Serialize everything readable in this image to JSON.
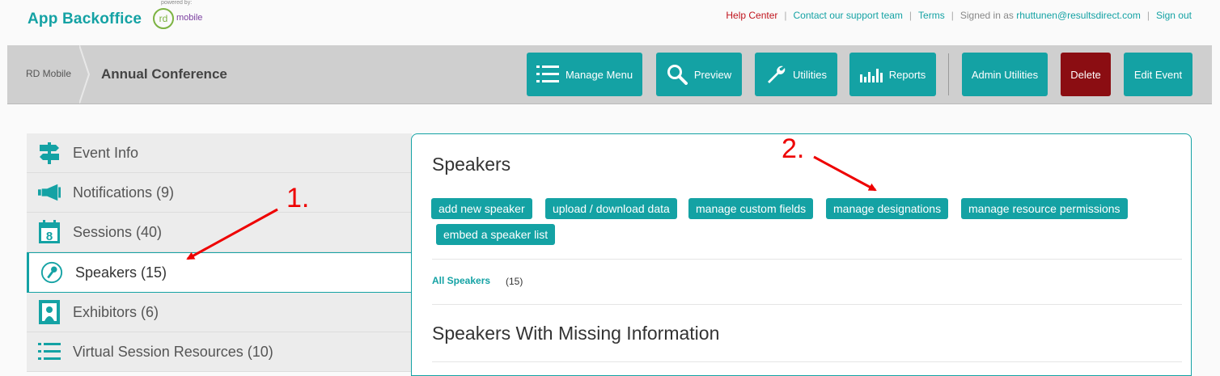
{
  "brand": {
    "title": "App Backoffice",
    "powered_by": "powered by:",
    "rd": "rd",
    "mobile": "mobile"
  },
  "toplinks": {
    "help": "Help Center",
    "contact": "Contact our support team",
    "terms": "Terms",
    "signed_in": "Signed in as",
    "email": "rhuttunen@resultsdirect.com",
    "sign_out": "Sign out",
    "separator": "|"
  },
  "breadcrumb": {
    "root": "RD Mobile",
    "current": "Annual Conference"
  },
  "header_buttons": {
    "manage_menu": "Manage Menu",
    "preview": "Preview",
    "utilities": "Utilities",
    "reports": "Reports",
    "admin_utilities": "Admin Utilities",
    "delete": "Delete",
    "edit_event": "Edit Event"
  },
  "sidebar": {
    "items": [
      {
        "label": "Event Info",
        "icon": "signpost-icon"
      },
      {
        "label": "Notifications (9)",
        "icon": "megaphone-icon"
      },
      {
        "label": "Sessions (40)",
        "icon": "calendar-icon"
      },
      {
        "label": "Speakers (15)",
        "icon": "microphone-icon"
      },
      {
        "label": "Exhibitors (6)",
        "icon": "booth-icon"
      },
      {
        "label": "Virtual Session Resources (10)",
        "icon": "list-icon"
      }
    ]
  },
  "panel": {
    "title": "Speakers",
    "actions": {
      "add": "add new speaker",
      "upload": "upload / download data",
      "custom_fields": "manage custom fields",
      "designations": "manage designations",
      "permissions": "manage resource permissions",
      "embed": "embed a speaker list"
    },
    "all_speakers_label": "All Speakers",
    "all_speakers_count": "(15)",
    "missing_title": "Speakers With Missing Information"
  },
  "annotations": {
    "one": "1.",
    "two": "2."
  },
  "colors": {
    "accent": "#14a2a4",
    "delete": "#8b0d12",
    "annotation": "#ee0000"
  }
}
